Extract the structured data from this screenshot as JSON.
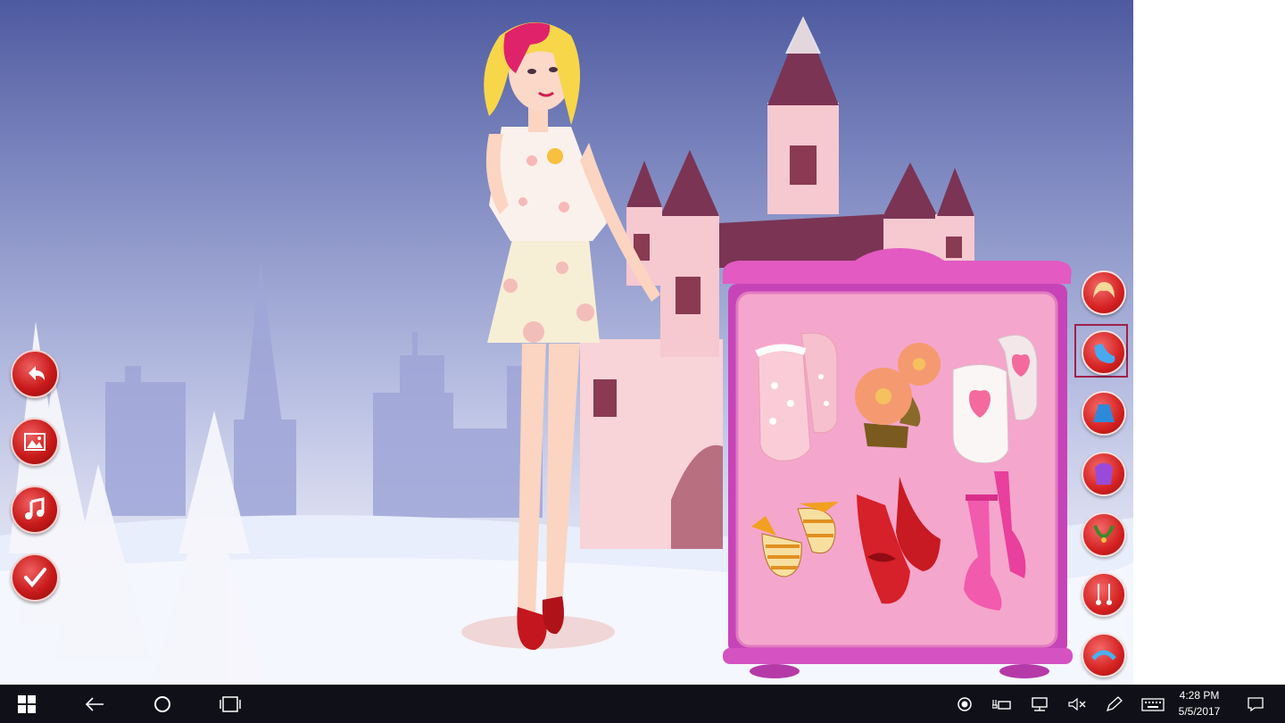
{
  "colors": {
    "accent_red": "#c81a1a",
    "wardrobe_pink": "#f4a6c8",
    "wardrobe_frame": "#d04ec0",
    "taskbar": "#101018"
  },
  "side_menu": [
    {
      "icon": "back-arrow-icon"
    },
    {
      "icon": "background-picture-icon"
    },
    {
      "icon": "music-note-icon"
    },
    {
      "icon": "checkmark-icon"
    }
  ],
  "categories": [
    {
      "icon": "hair-icon"
    },
    {
      "icon": "shoes-icon",
      "selected": true
    },
    {
      "icon": "skirt-icon"
    },
    {
      "icon": "top-icon"
    },
    {
      "icon": "necklace-icon"
    },
    {
      "icon": "earrings-icon"
    },
    {
      "icon": "headband-icon"
    }
  ],
  "wardrobe_items": [
    {
      "icon": "pink-polka-boots-icon"
    },
    {
      "icon": "flower-sandals-icon"
    },
    {
      "icon": "heart-slippers-icon"
    },
    {
      "icon": "striped-bow-flats-icon"
    },
    {
      "icon": "red-bow-heels-icon"
    },
    {
      "icon": "pink-strap-heels-icon"
    }
  ],
  "taskbar": {
    "time": "4:28 PM",
    "date": "5/5/2017"
  }
}
